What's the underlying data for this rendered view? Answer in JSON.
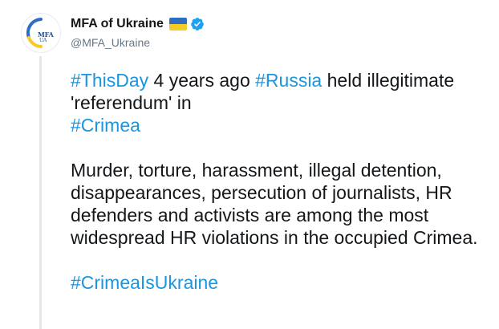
{
  "account": {
    "display_name": "MFA of Ukraine",
    "handle": "@MFA_Ukraine",
    "avatar_text": "MFA",
    "avatar_subtext": "UA",
    "verified": true,
    "name_flag_icon": "ukraine-flag-icon",
    "verified_icon": "verified-badge-icon"
  },
  "tweet": {
    "line1": {
      "hashtag_thisday": "#ThisDay",
      "text_a": " 4 years ago ",
      "hashtag_russia": "#Russia",
      "text_b": " held illegitimate 'referendum' in ",
      "inline_flag_icon": "ukraine-flag-icon",
      "hashtag_crimea": "#Crimea"
    },
    "paragraph2": "Murder, torture, harassment, illegal detention, disappearances, persecution of journalists, HR defenders and activists are among the most widespread HR violations in the occupied Crimea.",
    "hashtag_final": "#CrimeaIsUkraine"
  },
  "colors": {
    "link": "#1b95e0",
    "text": "#14171a",
    "secondary": "#657786",
    "flag_blue": "#2f6cc4",
    "flag_yellow": "#f7cb25",
    "verified": "#1da1f2"
  }
}
